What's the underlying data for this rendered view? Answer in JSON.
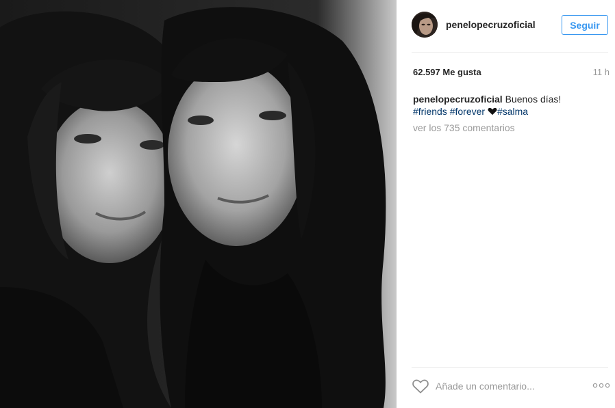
{
  "post": {
    "username": "penelopecruzoficial",
    "follow_label": "Seguir",
    "likes": "62.597 Me gusta",
    "time": "11 h",
    "caption": {
      "username": "penelopecruzoficial",
      "text": "Buenos días!",
      "tags": [
        "#friends",
        "#forever",
        "#salma"
      ],
      "emoji": "black-heart-emoji"
    },
    "view_comments": "ver los 735 comentarios",
    "comment_placeholder": "Añade un comentario...",
    "icons": {
      "like": "heart-outline-icon",
      "more": "more-options-icon"
    }
  },
  "colors": {
    "accent": "#3897f0",
    "hashtag": "#003569",
    "muted": "#999999",
    "text": "#262626"
  }
}
